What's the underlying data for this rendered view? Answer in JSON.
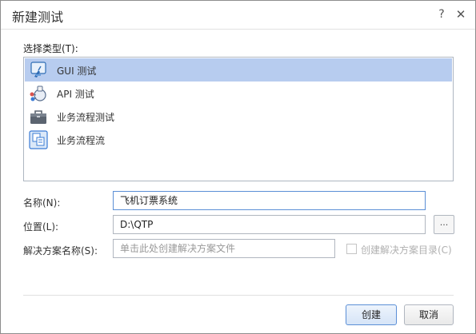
{
  "dialog": {
    "title": "新建测试",
    "help_symbol": "?",
    "close_symbol": "✕"
  },
  "type_section": {
    "label": "选择类型(T):",
    "items": [
      {
        "label": "GUI 测试",
        "icon": "gui-test-icon",
        "selected": true
      },
      {
        "label": "API 测试",
        "icon": "api-test-icon",
        "selected": false
      },
      {
        "label": "业务流程测试",
        "icon": "business-process-test-icon",
        "selected": false
      },
      {
        "label": "业务流程流",
        "icon": "business-process-flow-icon",
        "selected": false
      }
    ]
  },
  "form": {
    "name_label": "名称(N):",
    "name_value": "飞机订票系统",
    "location_label": "位置(L):",
    "location_value": "D:\\QTP",
    "browse_label": "...",
    "solution_label": "解决方案名称(S):",
    "solution_placeholder": "单击此处创建解决方案文件",
    "solution_checkbox_label": "创建解决方案目录(C)"
  },
  "buttons": {
    "create": "创建",
    "cancel": "取消"
  },
  "colors": {
    "selection": "#b7ccef",
    "focus_border": "#5b8fd6",
    "disabled_text": "#b0b0b0"
  }
}
